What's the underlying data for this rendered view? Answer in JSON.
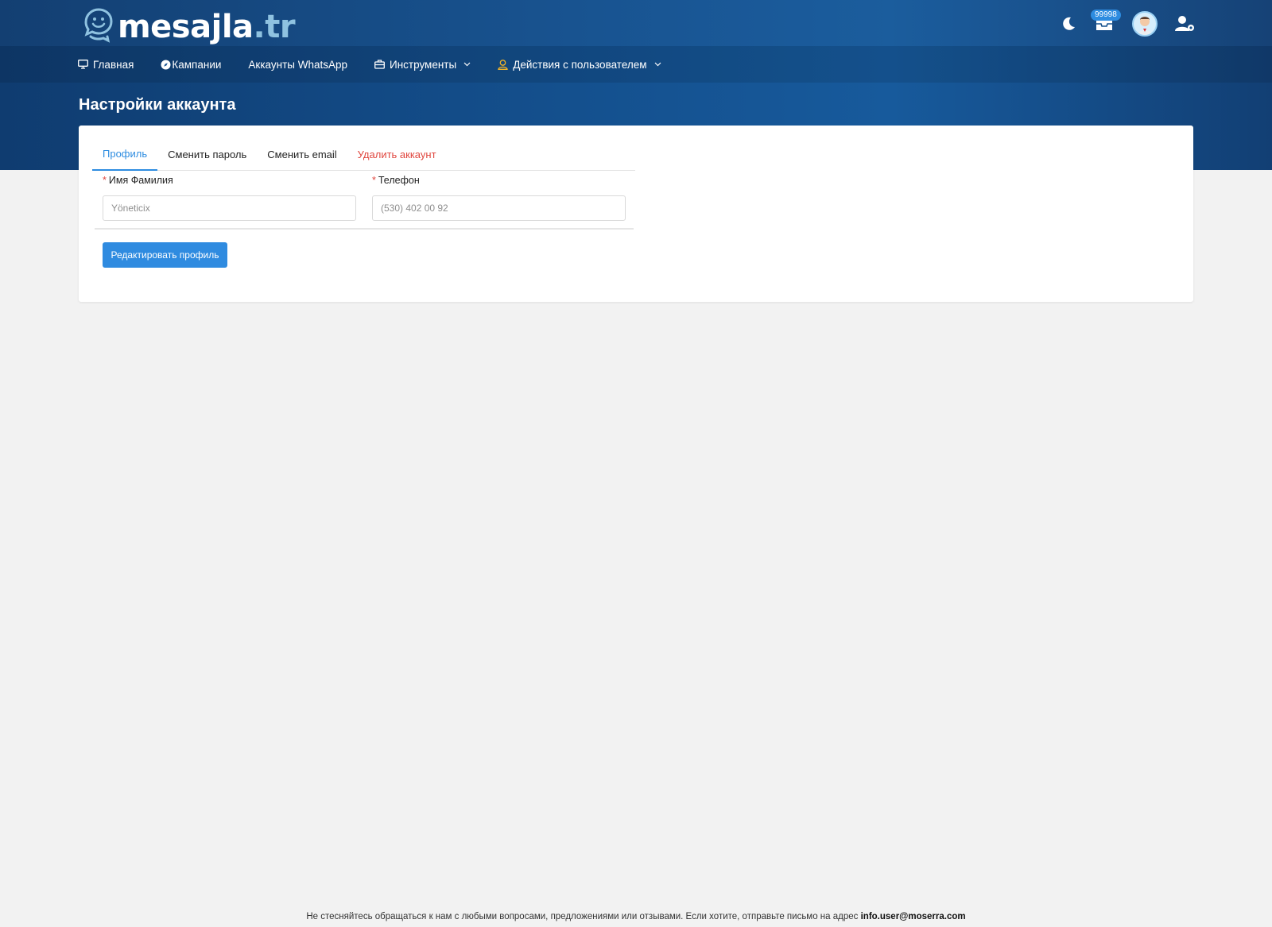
{
  "brand": {
    "name": "mesajla",
    "tld": ".tr"
  },
  "header": {
    "badge_count": "99998"
  },
  "nav": {
    "items": [
      {
        "label": "Главная",
        "icon": "monitor-icon"
      },
      {
        "label": "Кампании",
        "icon": "compass-icon"
      },
      {
        "label": "Аккаунты WhatsApp"
      },
      {
        "label": "Инструменты",
        "icon": "briefcase-icon",
        "dropdown": true
      },
      {
        "label": "Действия с пользователем",
        "icon": "user-icon",
        "dropdown": true
      }
    ]
  },
  "page": {
    "title": "Настройки аккаунта"
  },
  "tabs": [
    {
      "label": "Профиль",
      "active": true
    },
    {
      "label": "Сменить пароль"
    },
    {
      "label": "Сменить email"
    },
    {
      "label": "Удалить аккаунт",
      "danger": true
    }
  ],
  "form": {
    "name": {
      "label": "Имя Фамилия",
      "required_mark": "*",
      "placeholder": "Yöneticix"
    },
    "phone": {
      "label": "Телефон",
      "required_mark": "*",
      "placeholder": "(530) 402 00 92"
    },
    "submit_label": "Редактировать профиль"
  },
  "footer": {
    "text": "Не стесняйтесь обращаться к нам с любыми вопросами, предложениями или отзывами. Если хотите, отправьте письмо на адрес",
    "email": "info.user@moserra.com"
  },
  "colors": {
    "primary": "#2d8ce0",
    "danger": "#e0463e",
    "header_dark": "#0f3c70",
    "header_light": "#175a9c"
  }
}
